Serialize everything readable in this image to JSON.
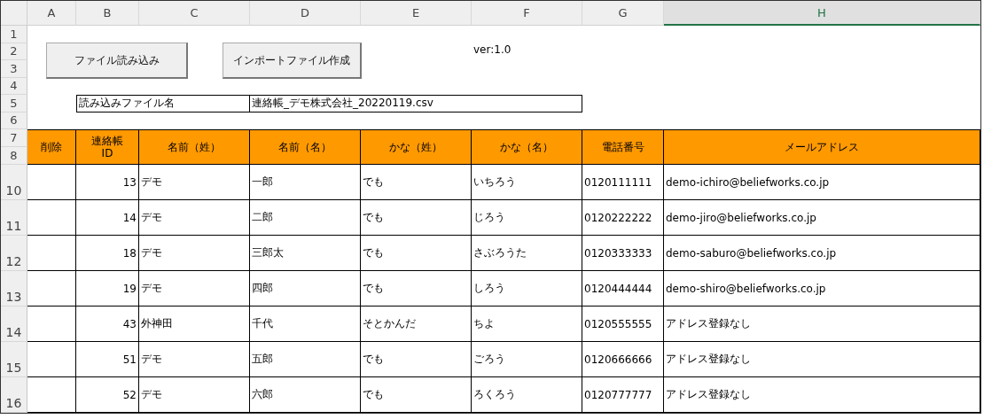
{
  "column_headers": [
    {
      "label": "A",
      "selected": false
    },
    {
      "label": "B",
      "selected": false
    },
    {
      "label": "C",
      "selected": false
    },
    {
      "label": "D",
      "selected": false
    },
    {
      "label": "E",
      "selected": false
    },
    {
      "label": "F",
      "selected": false
    },
    {
      "label": "G",
      "selected": false
    },
    {
      "label": "H",
      "selected": true
    }
  ],
  "top_row_numbers": [
    "1",
    "2",
    "3",
    "4",
    "5",
    "6",
    "7",
    "8"
  ],
  "buttons": [
    "ファイル読み込み",
    "インポートファイル作成"
  ],
  "version": "ver:1.0",
  "file_name": {
    "label": "読み込みファイル名",
    "value": "連絡帳_デモ株式会社_20220119.csv"
  },
  "table": {
    "columns": [
      "削除",
      "連絡帳\nID",
      "名前（姓）",
      "名前（名）",
      "かな（姓）",
      "かな（名）",
      "電話番号",
      "メールアドレス"
    ],
    "rows": [
      {
        "row_number": "10",
        "cells": [
          "",
          "13",
          "デモ",
          "一郎",
          "でも",
          "いちろう",
          "0120111111",
          "demo-ichiro@beliefworks.co.jp"
        ]
      },
      {
        "row_number": "11",
        "cells": [
          "",
          "14",
          "デモ",
          "二郎",
          "でも",
          "じろう",
          "0120222222",
          "demo-jiro@beliefworks.co.jp"
        ]
      },
      {
        "row_number": "12",
        "cells": [
          "",
          "18",
          "デモ",
          "三郎太",
          "でも",
          "さぶろうた",
          "0120333333",
          "demo-saburo@beliefworks.co.jp"
        ]
      },
      {
        "row_number": "13",
        "cells": [
          "",
          "19",
          "デモ",
          "四郎",
          "でも",
          "しろう",
          "0120444444",
          "demo-shiro@beliefworks.co.jp"
        ]
      },
      {
        "row_number": "14",
        "cells": [
          "",
          "43",
          "外神田",
          "千代",
          "そとかんだ",
          "ちよ",
          "0120555555",
          "アドレス登録なし"
        ]
      },
      {
        "row_number": "15",
        "cells": [
          "",
          "51",
          "デモ",
          "五郎",
          "でも",
          "ごろう",
          "0120666666",
          "アドレス登録なし"
        ]
      },
      {
        "row_number": "16",
        "cells": [
          "",
          "52",
          "デモ",
          "六郎",
          "でも",
          "ろくろう",
          "0120777777",
          "アドレス登録なし"
        ]
      }
    ]
  }
}
